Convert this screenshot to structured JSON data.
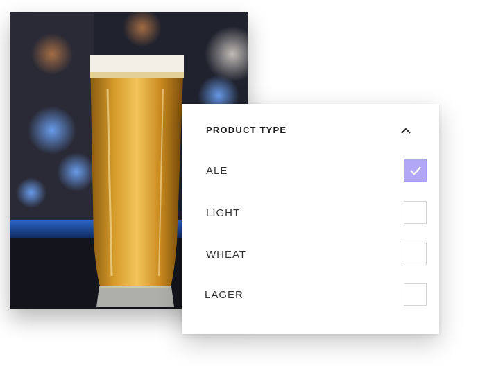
{
  "filter": {
    "title": "PRODUCT TYPE",
    "options": [
      {
        "label": "ALE",
        "checked": true
      },
      {
        "label": "LIGHT",
        "checked": false
      },
      {
        "label": "WHEAT",
        "checked": false
      },
      {
        "label": "LAGER",
        "checked": false
      }
    ]
  },
  "colors": {
    "accent": "#b2a7f5",
    "text": "#333333",
    "checkbox_border": "#d3d3d3"
  },
  "icons": {
    "collapse": "chevron-up-icon",
    "check": "checkmark-icon"
  }
}
